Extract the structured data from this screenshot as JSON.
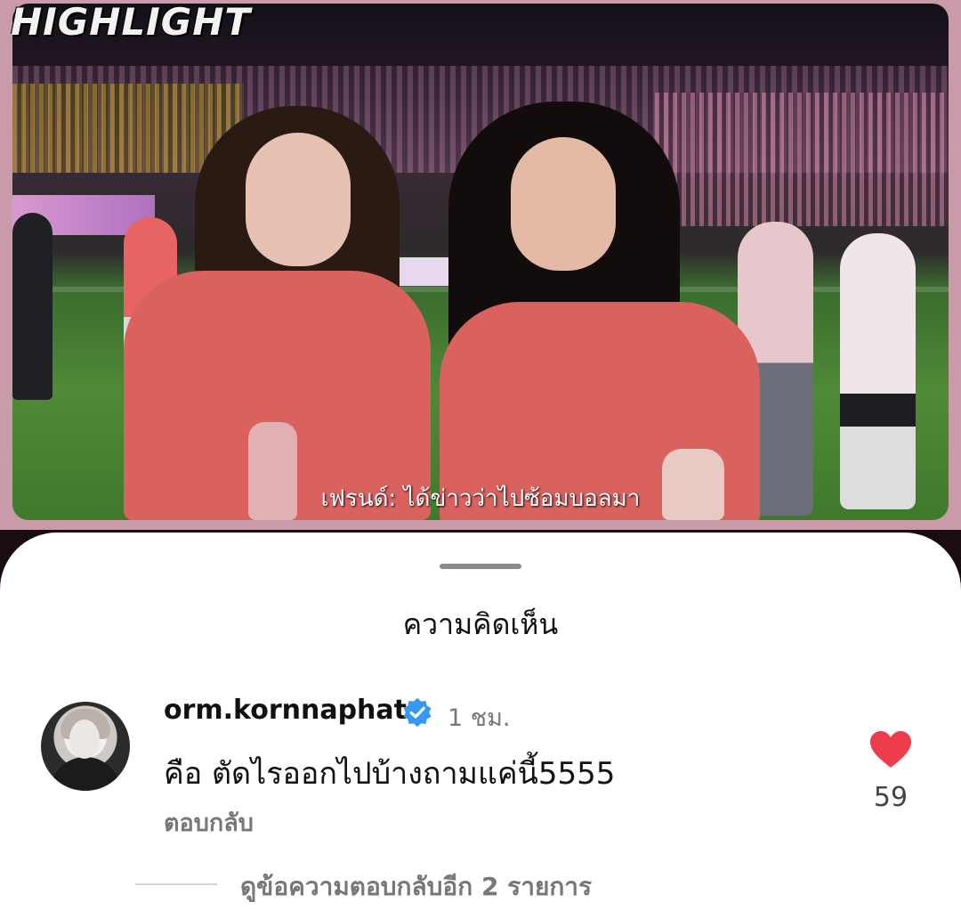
{
  "video": {
    "badge": "HIGHLIGHT",
    "subtitle": "เฟรนด์: ได้ข่าวว่าไปซ้อมบอลมา"
  },
  "comments_sheet": {
    "title": "ความคิดเห็น",
    "comment": {
      "username": "orm.kornnaphat",
      "verified": true,
      "timestamp": "1 ชม.",
      "text": "คือ ตัดไรออกไปบ้างถามแค่นี้5555",
      "reply_label": "ตอบกลับ",
      "likes": "59",
      "liked": true,
      "view_replies_label": "ดูข้อความตอบกลับอีก 2 รายการ"
    }
  },
  "colors": {
    "heart": "#ed3d4d",
    "verified_badge": "#3897f0",
    "secondary_text": "#777777"
  },
  "icons": [
    "verified-badge-icon",
    "heart-icon"
  ]
}
